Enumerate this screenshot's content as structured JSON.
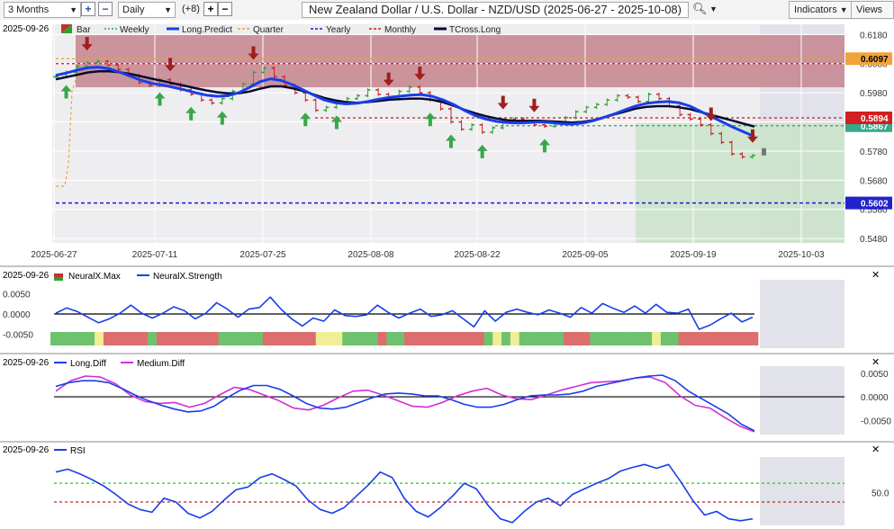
{
  "toolbar": {
    "range": "3 Months",
    "interval": "Daily",
    "offset": "(+8)",
    "title": "New Zealand Dollar / U.S. Dollar - NZD/USD (2025-06-27 - 2025-10-08)",
    "indicators": "Indicators",
    "views": "Views"
  },
  "panes": {
    "price": {
      "date": "2025-09-26"
    },
    "neural": {
      "date": "2025-09-26"
    },
    "diff": {
      "date": "2025-09-26"
    },
    "rsi": {
      "date": "2025-09-26"
    }
  },
  "legends": {
    "price": [
      "Bar",
      "Weekly",
      "Long.Predict",
      "Quarter",
      "Yearly",
      "Monthly",
      "TCross.Long"
    ],
    "neural": [
      "NeuralX.Max",
      "NeuralX.Strength"
    ],
    "diff": [
      "Long.Diff",
      "Medium.Diff"
    ],
    "rsi": [
      "RSI"
    ]
  },
  "colors": {
    "long_predict": "#1a3ee8",
    "tcross": "#0a0a30",
    "weekly": "#3aa060",
    "monthly": "#d01818",
    "yearly": "#1a1acc",
    "quarter": "#f0a030",
    "up_arrow": "#3aa64a",
    "down_arrow": "#a01e1e",
    "neural_green": "#6ec26e",
    "neural_red": "#dc6e6e",
    "neural_yellow": "#f0ee96",
    "medium_diff": "#d030d0",
    "rsi_upper": "#22cc22",
    "rsi_lower": "#cc2222"
  },
  "chart_data": [
    {
      "type": "candlestick",
      "title": "New Zealand Dollar / U.S. Dollar - NZD/USD (2025-06-27 - 2025-10-08)",
      "x_ticks": [
        "2025-06-27",
        "2025-07-11",
        "2025-07-25",
        "2025-08-08",
        "2025-08-22",
        "2025-09-05",
        "2025-09-19",
        "2025-10-03"
      ],
      "y_ticks": [
        0.618,
        0.608,
        0.598,
        0.588,
        0.578,
        0.568,
        0.558,
        0.548
      ],
      "ylim": [
        0.5465,
        0.6215
      ],
      "price_labels": {
        "quarter": 0.6097,
        "monthly": 0.5894,
        "weekly": 0.5867,
        "yearly": 0.5602
      },
      "close": [
        0.6035,
        0.605,
        0.607,
        0.6082,
        0.6088,
        0.6075,
        0.606,
        0.604,
        0.6015,
        0.6005,
        0.6025,
        0.601,
        0.599,
        0.5975,
        0.5955,
        0.5945,
        0.596,
        0.5985,
        0.601,
        0.605,
        0.6065,
        0.6035,
        0.6005,
        0.598,
        0.5955,
        0.592,
        0.593,
        0.5945,
        0.596,
        0.597,
        0.599,
        0.5975,
        0.596,
        0.5985,
        0.6,
        0.598,
        0.5955,
        0.5925,
        0.588,
        0.5855,
        0.587,
        0.5845,
        0.586,
        0.588,
        0.589,
        0.588,
        0.587,
        0.5865,
        0.5875,
        0.5895,
        0.5915,
        0.593,
        0.594,
        0.5955,
        0.597,
        0.5965,
        0.595,
        0.5975,
        0.596,
        0.5935,
        0.5905,
        0.589,
        0.587,
        0.584,
        0.581,
        0.577,
        0.576,
        0.5765
      ],
      "long_predict": [
        0.604,
        0.6048,
        0.6058,
        0.6066,
        0.6068,
        0.6062,
        0.605,
        0.6036,
        0.6022,
        0.6012,
        0.6006,
        0.5998,
        0.599,
        0.598,
        0.5972,
        0.5968,
        0.597,
        0.598,
        0.5998,
        0.6018,
        0.6028,
        0.6022,
        0.6008,
        0.599,
        0.5972,
        0.5955,
        0.5946,
        0.5942,
        0.5944,
        0.595,
        0.5958,
        0.5964,
        0.5968,
        0.5972,
        0.5974,
        0.5968,
        0.5956,
        0.594,
        0.592,
        0.5902,
        0.589,
        0.5882,
        0.5878,
        0.5876,
        0.5878,
        0.588,
        0.5878,
        0.5874,
        0.5872,
        0.5876,
        0.5884,
        0.5896,
        0.5908,
        0.5922,
        0.5935,
        0.5944,
        0.5948,
        0.595,
        0.5946,
        0.5934,
        0.5916,
        0.5898,
        0.588,
        0.5862,
        0.5846,
        0.583
      ],
      "tcross_long": [
        0.6026,
        0.6034,
        0.6042,
        0.605,
        0.6054,
        0.6054,
        0.605,
        0.6044,
        0.6036,
        0.6028,
        0.602,
        0.6012,
        0.6004,
        0.5996,
        0.5988,
        0.5982,
        0.5978,
        0.5978,
        0.5984,
        0.5994,
        0.6002,
        0.6002,
        0.5996,
        0.5986,
        0.5974,
        0.5962,
        0.5954,
        0.5948,
        0.5946,
        0.5948,
        0.5952,
        0.5956,
        0.5958,
        0.596,
        0.596,
        0.5956,
        0.5948,
        0.5936,
        0.5922,
        0.591,
        0.59,
        0.5892,
        0.5886,
        0.5884,
        0.5884,
        0.5884,
        0.5882,
        0.588,
        0.5878,
        0.588,
        0.5886,
        0.5896,
        0.5906,
        0.5916,
        0.5926,
        0.5932,
        0.5934,
        0.5934,
        0.593,
        0.5924,
        0.5914,
        0.5904,
        0.5894,
        0.5884,
        0.5874,
        0.5864
      ],
      "up_arrow_bars": [
        2,
        13,
        17,
        22,
        33,
        37,
        49,
        51,
        56,
        64
      ],
      "down_arrow_bars": [
        4,
        15,
        26,
        43,
        47,
        58,
        63,
        85,
        91
      ]
    },
    {
      "type": "line",
      "name": "NeuralX.Strength",
      "y_ticks": [
        0.005,
        0.0,
        -0.005
      ],
      "ylim": [
        -0.0085,
        0.0085
      ],
      "values": [
        0.0002,
        0.0015,
        0.0006,
        -0.0008,
        -0.0022,
        -0.0012,
        0.0002,
        0.0022,
        0.0002,
        -0.001,
        0.0002,
        0.0018,
        0.0008,
        -0.0012,
        0.0002,
        0.0028,
        0.0012,
        -0.0008,
        0.0012,
        0.0016,
        0.0042,
        0.0012,
        -0.0012,
        -0.003,
        -0.001,
        -0.0018,
        0.001,
        -0.0004,
        -0.0006,
        -0.0002,
        0.0022,
        0.0004,
        -0.001,
        0.0002,
        0.0012,
        -0.0006,
        -0.0002,
        0.0008,
        -0.0012,
        -0.0032,
        0.0008,
        -0.0018,
        0.0004,
        0.0012,
        0.0004,
        -0.0002,
        0.001,
        0.0002,
        -0.0008,
        0.0016,
        0.0002,
        0.0026,
        0.0014,
        0.0004,
        0.002,
        0.0002,
        0.0024,
        0.0004,
        0.0002,
        0.0012,
        -0.0038,
        -0.0028,
        -0.0012,
        0.0002,
        -0.002,
        -0.0008
      ],
      "bar_colors": [
        "g",
        "g",
        "g",
        "g",
        "g",
        "y",
        "r",
        "r",
        "r",
        "r",
        "r",
        "g",
        "r",
        "r",
        "r",
        "r",
        "r",
        "r",
        "r",
        "g",
        "g",
        "g",
        "g",
        "g",
        "r",
        "r",
        "r",
        "r",
        "r",
        "r",
        "y",
        "y",
        "y",
        "g",
        "g",
        "g",
        "g",
        "r",
        "g",
        "g",
        "r",
        "r",
        "r",
        "r",
        "r",
        "r",
        "r",
        "r",
        "r",
        "g",
        "y",
        "g",
        "y",
        "g",
        "g",
        "g",
        "g",
        "g",
        "r",
        "r",
        "r",
        "g",
        "g",
        "g",
        "g",
        "g",
        "g",
        "g",
        "y",
        "g",
        "g",
        "r",
        "r",
        "r",
        "r",
        "r",
        "r",
        "r",
        "r",
        "r"
      ]
    },
    {
      "type": "line",
      "series_names": [
        "Long.Diff",
        "Medium.Diff"
      ],
      "y_ticks": [
        0.005,
        0.0,
        -0.005
      ],
      "ylim": [
        -0.008,
        0.0065
      ],
      "long_diff": [
        0.0022,
        0.003,
        0.0034,
        0.0034,
        0.003,
        0.0018,
        0.0004,
        -0.0008,
        -0.0018,
        -0.0026,
        -0.0032,
        -0.003,
        -0.002,
        -0.0002,
        0.0014,
        0.0024,
        0.0024,
        0.0016,
        0.0002,
        -0.0014,
        -0.0024,
        -0.0026,
        -0.0022,
        -0.0012,
        -0.0002,
        0.0006,
        0.0008,
        0.0006,
        0.0002,
        0.0002,
        -0.0006,
        -0.0016,
        -0.0022,
        -0.0022,
        -0.0016,
        -0.0006,
        0.0002,
        0.0004,
        0.0004,
        0.0006,
        0.0012,
        0.0022,
        0.0028,
        0.0034,
        0.004,
        0.0044,
        0.0046,
        0.0034,
        0.0012,
        -0.0004,
        -0.002,
        -0.0036,
        -0.0058,
        -0.0072
      ],
      "medium_diff": [
        0.0012,
        0.0034,
        0.0044,
        0.0042,
        0.0028,
        0.0004,
        -0.001,
        -0.0014,
        -0.0012,
        -0.0022,
        -0.0014,
        0.0004,
        0.002,
        0.0016,
        0.0004,
        -0.0008,
        -0.0024,
        -0.0028,
        -0.0018,
        -0.0002,
        0.0012,
        0.0014,
        0.0004,
        -0.0008,
        -0.002,
        -0.0022,
        -0.0012,
        0.0002,
        0.0012,
        0.0018,
        0.0004,
        -0.0004,
        -0.0006,
        0.0004,
        0.0014,
        0.0022,
        0.003,
        0.0032,
        0.0034,
        0.004,
        0.0042,
        0.003,
        0.0002,
        -0.0018,
        -0.0024,
        -0.0044,
        -0.0062,
        -0.0074
      ]
    },
    {
      "type": "line",
      "name": "RSI",
      "y_ticks": [
        50.0
      ],
      "ylim": [
        15,
        88
      ],
      "upper_level": 60,
      "lower_level": 40,
      "values": [
        72,
        75,
        70,
        64,
        57,
        48,
        38,
        32,
        29,
        44,
        40,
        28,
        23,
        30,
        42,
        53,
        56,
        66,
        70,
        64,
        57,
        42,
        32,
        28,
        34,
        46,
        58,
        72,
        66,
        44,
        30,
        24,
        34,
        46,
        60,
        54,
        36,
        22,
        18,
        30,
        40,
        44,
        36,
        48,
        54,
        60,
        65,
        73,
        77,
        80,
        76,
        80,
        62,
        42,
        26,
        30,
        22,
        20,
        22
      ]
    }
  ]
}
